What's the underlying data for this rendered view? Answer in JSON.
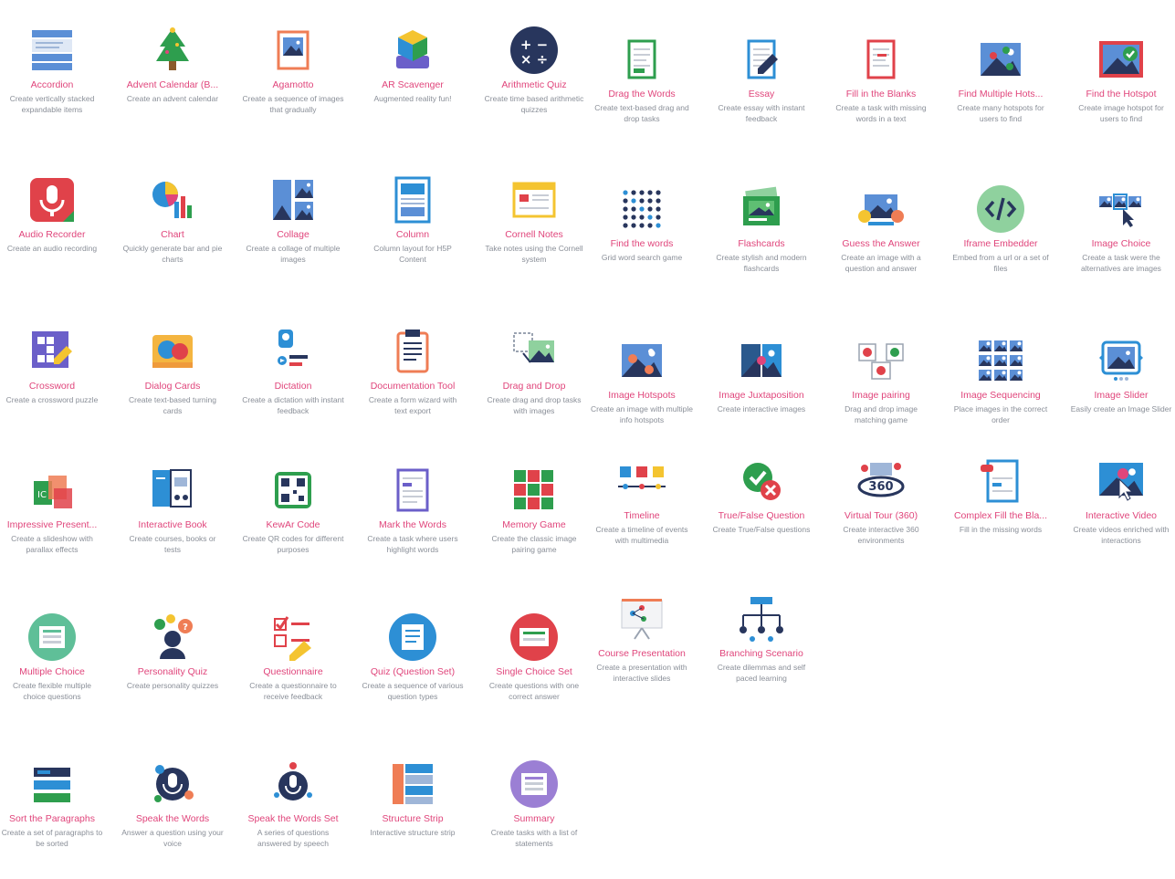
{
  "colors": {
    "title": "#e0457b",
    "desc": "#8a8f98",
    "blue": "#2d8fd5",
    "navy": "#28365d"
  },
  "tiles": [
    {
      "icon": "accordion-icon",
      "title": "Accordion",
      "desc": "Create vertically stacked expandable items"
    },
    {
      "icon": "christmas-tree-icon",
      "title": "Advent Calendar (B...",
      "desc": "Create an advent calendar"
    },
    {
      "icon": "picture-frame-icon",
      "title": "Agamotto",
      "desc": "Create a sequence of images that gradually"
    },
    {
      "icon": "ar-cube-icon",
      "title": "AR Scavenger",
      "desc": "Augmented reality fun!"
    },
    {
      "icon": "math-operators-icon",
      "title": "Arithmetic Quiz",
      "desc": "Create time based arithmetic quizzes"
    },
    {
      "icon": "drag-document-icon",
      "title": "Drag the Words",
      "desc": "Create text-based drag and drop tasks"
    },
    {
      "icon": "essay-pen-icon",
      "title": "Essay",
      "desc": "Create essay with instant feedback"
    },
    {
      "icon": "fill-blanks-document-icon",
      "title": "Fill in the Blanks",
      "desc": "Create a task with missing words in a text"
    },
    {
      "icon": "multiple-hotspots-icon",
      "title": "Find Multiple Hots...",
      "desc": "Create many hotspots for users to find"
    },
    {
      "icon": "hotspot-check-icon",
      "title": "Find the Hotspot",
      "desc": "Create image hotspot for users to find"
    },
    {
      "icon": "microphone-icon",
      "title": "Audio Recorder",
      "desc": "Create an audio recording"
    },
    {
      "icon": "chart-icon",
      "title": "Chart",
      "desc": "Quickly generate bar and pie charts"
    },
    {
      "icon": "collage-icon",
      "title": "Collage",
      "desc": "Create a collage of multiple images"
    },
    {
      "icon": "column-layout-icon",
      "title": "Column",
      "desc": "Column layout for H5P Content"
    },
    {
      "icon": "cornell-notes-icon",
      "title": "Cornell Notes",
      "desc": "Take notes using the Cornell system"
    },
    {
      "icon": "word-search-grid-icon",
      "title": "Find the words",
      "desc": "Grid word search game"
    },
    {
      "icon": "flashcards-icon",
      "title": "Flashcards",
      "desc": "Create stylish and modern flashcards"
    },
    {
      "icon": "guess-answer-icon",
      "title": "Guess the Answer",
      "desc": "Create an image with a question and answer"
    },
    {
      "icon": "code-embed-icon",
      "title": "Iframe Embedder",
      "desc": "Embed from a url or a set of files"
    },
    {
      "icon": "image-choice-icon",
      "title": "Image Choice",
      "desc": "Create a task were the alternatives are images"
    },
    {
      "icon": "crossword-icon",
      "title": "Crossword",
      "desc": "Create a crossword puzzle"
    },
    {
      "icon": "dialog-cards-icon",
      "title": "Dialog Cards",
      "desc": "Create text-based turning cards"
    },
    {
      "icon": "dictation-icon",
      "title": "Dictation",
      "desc": "Create a dictation with instant feedback"
    },
    {
      "icon": "clipboard-icon",
      "title": "Documentation Tool",
      "desc": "Create a form wizard with text export"
    },
    {
      "icon": "drag-drop-icon",
      "title": "Drag and Drop",
      "desc": "Create drag and drop tasks with images"
    },
    {
      "icon": "image-hotspots-icon",
      "title": "Image Hotspots",
      "desc": "Create an image with multiple info hotspots"
    },
    {
      "icon": "image-juxtaposition-icon",
      "title": "Image Juxtaposition",
      "desc": "Create interactive images"
    },
    {
      "icon": "image-pairing-icon",
      "title": "Image pairing",
      "desc": "Drag and drop image matching game"
    },
    {
      "icon": "image-sequencing-icon",
      "title": "Image Sequencing",
      "desc": "Place images in the correct order"
    },
    {
      "icon": "image-slider-icon",
      "title": "Image Slider",
      "desc": "Easily create an Image Slider"
    },
    {
      "icon": "impressive-presentation-icon",
      "title": "Impressive Present...",
      "desc": "Create a slideshow with parallax effects"
    },
    {
      "icon": "interactive-book-icon",
      "title": "Interactive Book",
      "desc": "Create courses, books or tests"
    },
    {
      "icon": "qr-code-icon",
      "title": "KewAr Code",
      "desc": "Create QR codes for different purposes"
    },
    {
      "icon": "mark-words-icon",
      "title": "Mark the Words",
      "desc": "Create a task where users highlight words"
    },
    {
      "icon": "memory-game-icon",
      "title": "Memory Game",
      "desc": "Create the classic image pairing game"
    },
    {
      "icon": "timeline-icon",
      "title": "Timeline",
      "desc": "Create a timeline of events with multimedia"
    },
    {
      "icon": "true-false-icon",
      "title": "True/False Question",
      "desc": "Create True/False questions"
    },
    {
      "icon": "virtual-tour-360-icon",
      "title": "Virtual Tour (360)",
      "desc": "Create interactive 360 environments"
    },
    {
      "icon": "complex-fill-blanks-icon",
      "title": "Complex Fill the Bla...",
      "desc": "Fill in the missing words"
    },
    {
      "icon": "interactive-video-icon",
      "title": "Interactive Video",
      "desc": "Create videos enriched with interactions"
    },
    {
      "icon": "multiple-choice-icon",
      "title": "Multiple Choice",
      "desc": "Create flexible multiple choice questions"
    },
    {
      "icon": "personality-quiz-icon",
      "title": "Personality Quiz",
      "desc": "Create personality quizzes"
    },
    {
      "icon": "questionnaire-icon",
      "title": "Questionnaire",
      "desc": "Create a questionnaire to receive feedback"
    },
    {
      "icon": "question-set-icon",
      "title": "Quiz (Question Set)",
      "desc": "Create a sequence of various question types"
    },
    {
      "icon": "single-choice-icon",
      "title": "Single Choice Set",
      "desc": "Create questions with one correct answer"
    },
    {
      "icon": "course-presentation-icon",
      "title": "Course Presentation",
      "desc": "Create a presentation with interactive slides"
    },
    {
      "icon": "branching-scenario-icon",
      "title": "Branching Scenario",
      "desc": "Create dilemmas and self paced learning"
    },
    {
      "icon": "sort-paragraphs-icon",
      "title": "Sort the Paragraphs",
      "desc": "Create a set of paragraphs to be sorted"
    },
    {
      "icon": "speak-words-icon",
      "title": "Speak the Words",
      "desc": "Answer a question using your voice"
    },
    {
      "icon": "speak-words-set-icon",
      "title": "Speak the Words Set",
      "desc": "A series of questions answered by speech"
    },
    {
      "icon": "structure-strip-icon",
      "title": "Structure Strip",
      "desc": "Interactive structure strip"
    },
    {
      "icon": "summary-icon",
      "title": "Summary",
      "desc": "Create tasks with a list of statements"
    }
  ]
}
